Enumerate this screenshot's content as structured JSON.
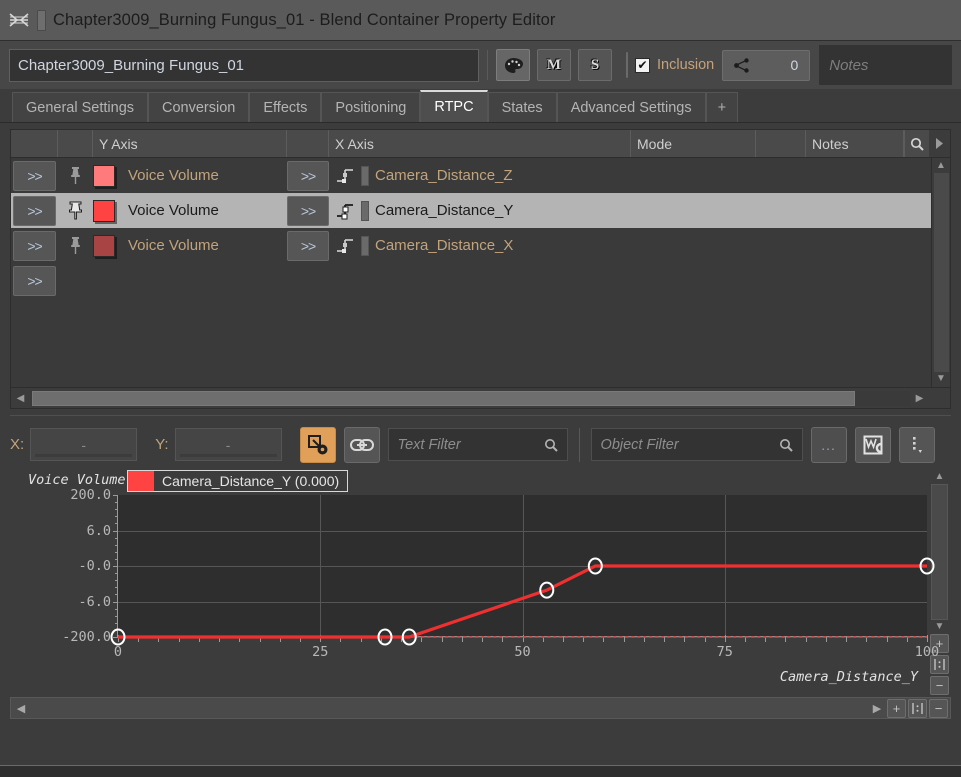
{
  "window": {
    "app_icon": "wwise-icon",
    "doc_icon": "document-bar-icon",
    "title": "Chapter3009_Burning Fungus_01 - Blend Container Property Editor"
  },
  "namebar": {
    "object_name": "Chapter3009_Burning Fungus_01",
    "palette_label": "●",
    "mute_label": "M",
    "solo_label": "S",
    "inclusion_label": "Inclusion",
    "inclusion_checked": "✔",
    "share_count": "0",
    "notes_placeholder": "Notes"
  },
  "tabs": [
    {
      "label": "General Settings",
      "active": false
    },
    {
      "label": "Conversion",
      "active": false
    },
    {
      "label": "Effects",
      "active": false
    },
    {
      "label": "Positioning",
      "active": false
    },
    {
      "label": "RTPC",
      "active": true
    },
    {
      "label": "States",
      "active": false
    },
    {
      "label": "Advanced Settings",
      "active": false
    },
    {
      "label": "+",
      "active": false
    }
  ],
  "table": {
    "headers": [
      "",
      "",
      "Y Axis",
      "",
      "X Axis",
      "Mode",
      "",
      "Notes"
    ],
    "goto_label": ">>",
    "rows": [
      {
        "y_name": "Voice Volume",
        "x_name": "Camera_Distance_Z",
        "swatch": "#FF7B7B",
        "pinned": false,
        "selected": false,
        "mode": "",
        "notes": ""
      },
      {
        "y_name": "Voice Volume",
        "x_name": "Camera_Distance_Y",
        "swatch": "#FF4242",
        "pinned": true,
        "selected": true,
        "mode": "",
        "notes": ""
      },
      {
        "y_name": "Voice Volume",
        "x_name": "Camera_Distance_X",
        "swatch": "#A84444",
        "pinned": false,
        "selected": false,
        "mode": "",
        "notes": ""
      }
    ],
    "empty_row_label": ">>"
  },
  "graph_toolbar": {
    "x_label": "X:",
    "x_value": "-",
    "y_label": "Y:",
    "y_value": "-",
    "curve_tool_icon": "curve-node-tool-icon",
    "link_icon": "link-icon",
    "text_filter_placeholder": "Text Filter",
    "object_filter_placeholder": "Object Filter",
    "more_label": "...",
    "ws_icon": "ws-icon",
    "menu_icon": "kebab-menu-icon"
  },
  "chart_data": {
    "type": "line",
    "title": "",
    "ylabel": "Voice Volume",
    "xlabel": "Camera_Distance_Y",
    "legend": {
      "label": "Camera_Distance_Y (0.000)",
      "color": "#FF4242",
      "position": "top-left"
    },
    "grid": true,
    "xlim": [
      0,
      100
    ],
    "xticks": [
      0,
      25,
      50,
      75,
      100
    ],
    "xtick_labels": [
      "0",
      "25",
      "50",
      "75",
      "100"
    ],
    "ytick_labels": [
      "200.0",
      "6.0",
      "-0.0",
      "-6.0",
      "-200.0"
    ],
    "ytick_positions": [
      1.0,
      0.75,
      0.5,
      0.25,
      0.0
    ],
    "series": [
      {
        "name": "Camera_Distance_Y",
        "color": "#F03030",
        "points": [
          {
            "x": 0,
            "y_norm": 0.0,
            "y_label": "-200.0"
          },
          {
            "x": 33,
            "y_norm": 0.0,
            "y_label": "-200.0"
          },
          {
            "x": 36,
            "y_norm": 0.0,
            "y_label": "-200.0"
          },
          {
            "x": 53,
            "y_norm": 0.33,
            "y_label": "-3.5"
          },
          {
            "x": 59,
            "y_norm": 0.5,
            "y_label": "-0.0"
          },
          {
            "x": 100,
            "y_norm": 0.5,
            "y_label": "-0.0"
          }
        ]
      }
    ]
  },
  "graph_controls": {
    "zoom_in_label": "+",
    "fit_label": "⌶",
    "zoom_out_label": "−",
    "scroll_left": "◀",
    "scroll_right": "▶",
    "scroll_up": "▲",
    "scroll_down": "▼"
  }
}
